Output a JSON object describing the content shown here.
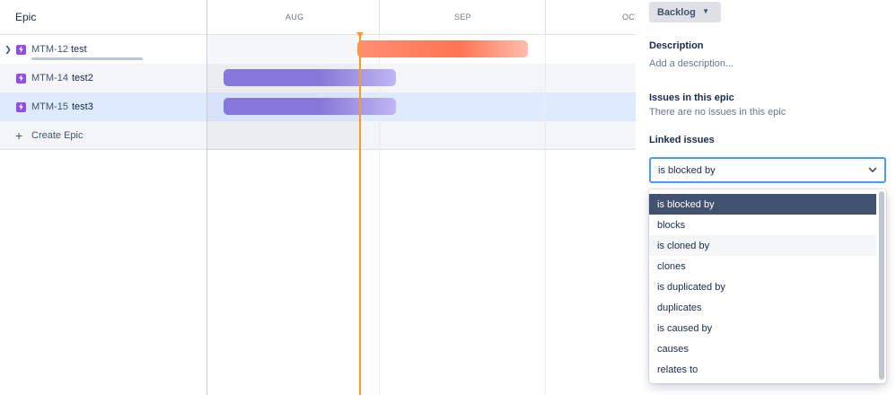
{
  "epic_column": {
    "header": "Epic",
    "create_label": "Create Epic"
  },
  "epics": [
    {
      "key": "MTM-12",
      "name": "test",
      "expandable": true
    },
    {
      "key": "MTM-14",
      "name": "test2",
      "expandable": false
    },
    {
      "key": "MTM-15",
      "name": "test3",
      "expandable": false
    }
  ],
  "timeline": {
    "months": [
      "AUG",
      "SEP",
      "OCT"
    ]
  },
  "panel": {
    "status": "Backlog",
    "description_title": "Description",
    "description_placeholder": "Add a description...",
    "issues_title": "Issues in this epic",
    "issues_text": "There are no issues in this epic",
    "linked_title": "Linked issues",
    "link_type_value": "is blocked by",
    "link_type_options": [
      "is blocked by",
      "blocks",
      "is cloned by",
      "clones",
      "is duplicated by",
      "duplicates",
      "is caused by",
      "causes",
      "relates to"
    ]
  },
  "colors": {
    "epic_icon": "#904ee2",
    "bar_red": "#ff7452",
    "bar_purple": "#8777d9",
    "today_line": "#ff991f",
    "selected_row": "#deebff",
    "menu_selected": "#42526e",
    "select_focus": "#4c9aff"
  }
}
